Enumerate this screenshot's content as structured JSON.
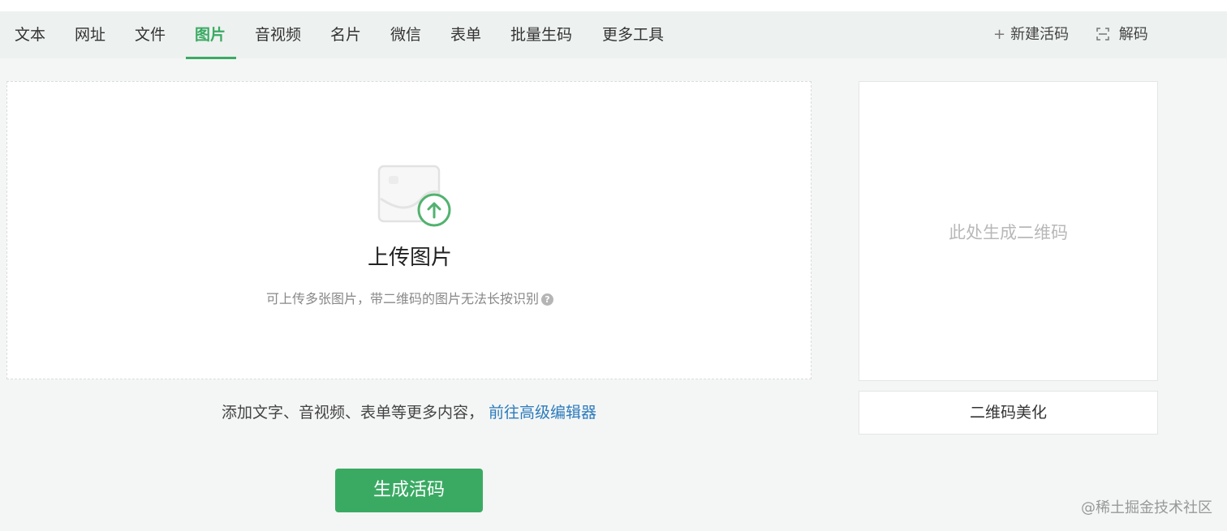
{
  "nav": {
    "tabs": [
      {
        "label": "文本"
      },
      {
        "label": "网址"
      },
      {
        "label": "文件"
      },
      {
        "label": "图片",
        "active": true
      },
      {
        "label": "音视频"
      },
      {
        "label": "名片"
      },
      {
        "label": "微信"
      },
      {
        "label": "表单"
      },
      {
        "label": "批量生码"
      },
      {
        "label": "更多工具"
      }
    ],
    "new_code_label": "新建活码",
    "decode_label": "解码"
  },
  "upload": {
    "title": "上传图片",
    "hint": "可上传多张图片，带二维码的图片无法长按识别",
    "help_icon": "?"
  },
  "editor": {
    "text": "添加文字、音视频、表单等更多内容，",
    "link": "前往高级编辑器"
  },
  "generate_button": "生成活码",
  "preview": {
    "placeholder": "此处生成二维码",
    "beautify_button": "二维码美化"
  },
  "watermark": "@稀土掘金技术社区",
  "colors": {
    "accent": "#3aaa63",
    "link": "#2c7bbd"
  }
}
